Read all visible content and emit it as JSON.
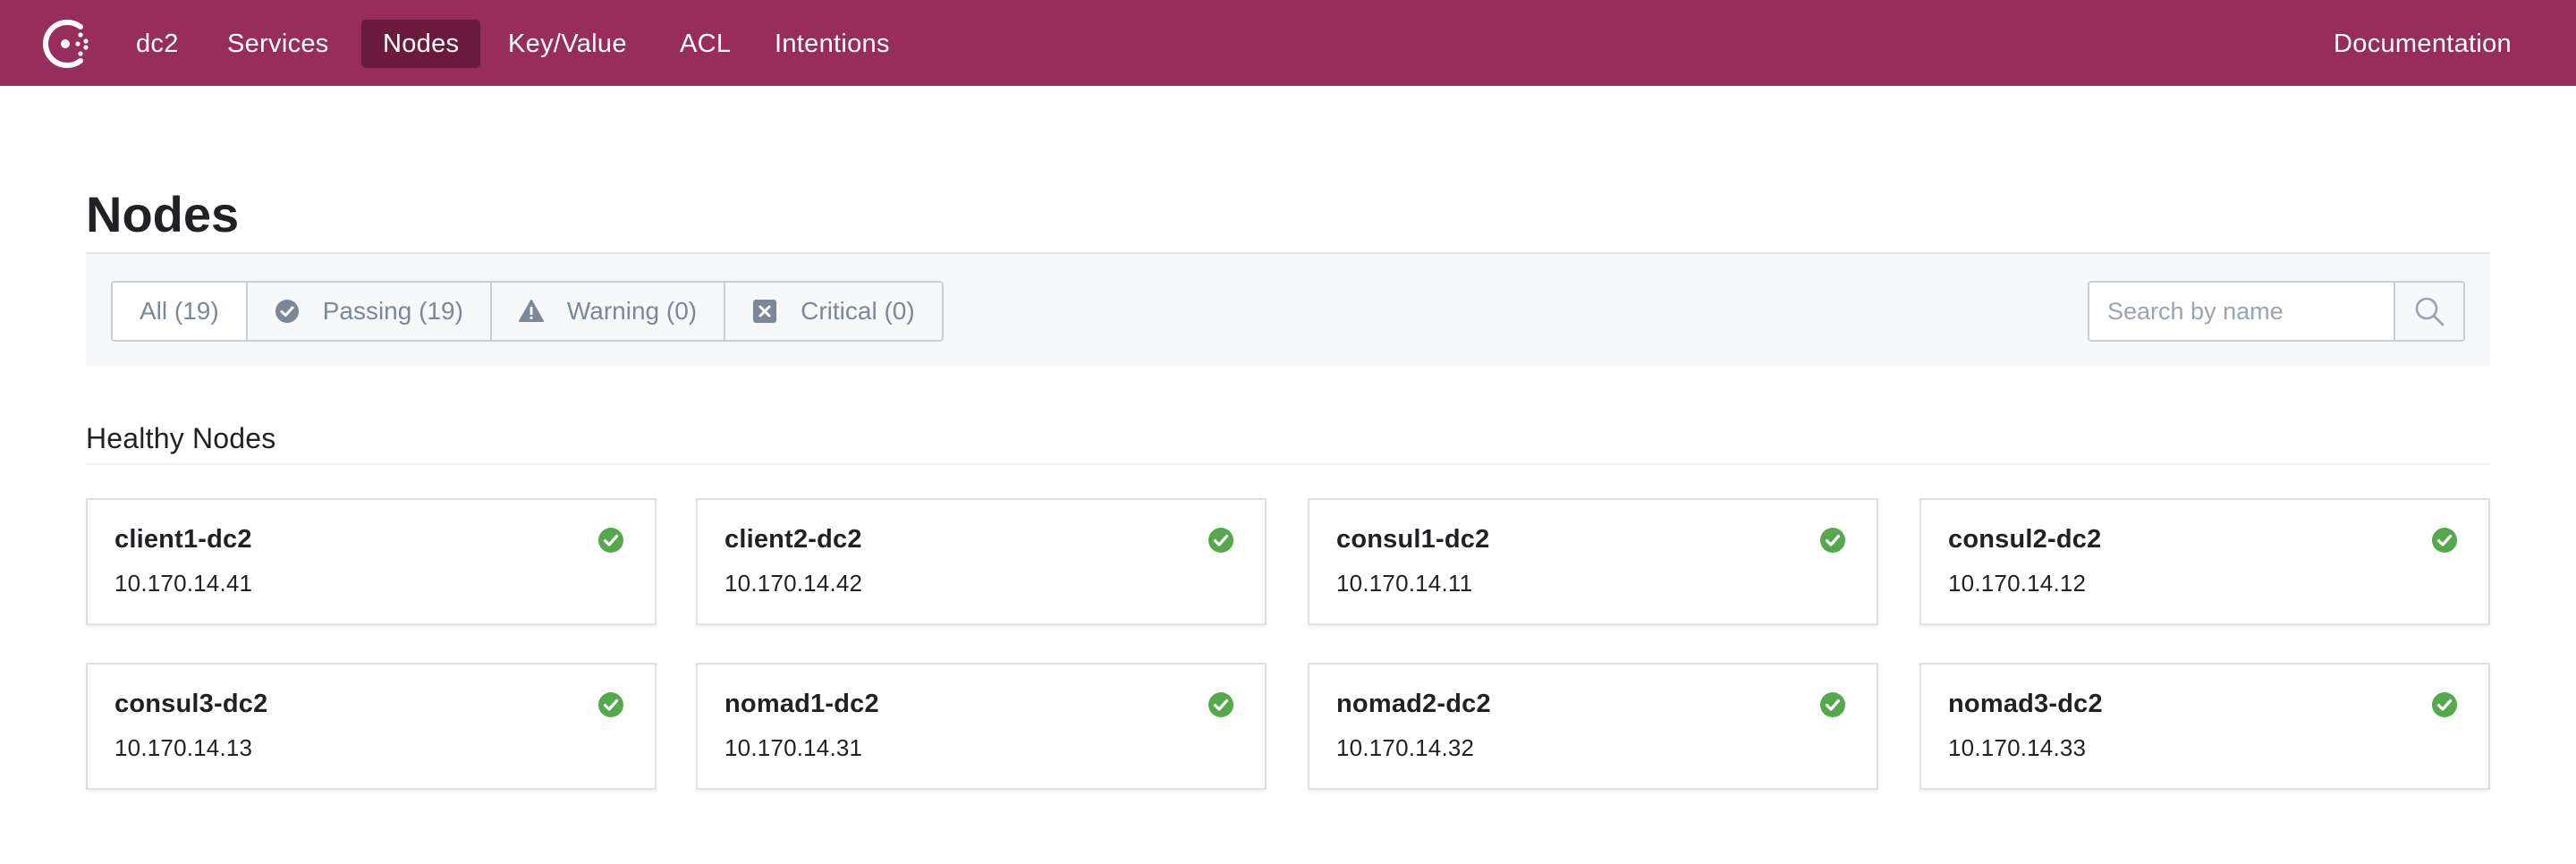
{
  "topnav": {
    "datacenter": "dc2",
    "items": [
      {
        "label": "Services",
        "active": false
      },
      {
        "label": "Nodes",
        "active": true
      },
      {
        "label": "Key/Value",
        "active": false
      },
      {
        "label": "ACL",
        "active": false
      },
      {
        "label": "Intentions",
        "active": false
      }
    ],
    "documentation": "Documentation",
    "brand_color": "#962d5b",
    "active_color": "#6a1b3c"
  },
  "page": {
    "title": "Nodes"
  },
  "filters": {
    "all": "All (19)",
    "passing": "Passing (19)",
    "warning": "Warning (0)",
    "critical": "Critical (0)"
  },
  "search": {
    "placeholder": "Search by name",
    "value": ""
  },
  "section": {
    "heading": "Healthy Nodes"
  },
  "nodes": [
    {
      "name": "client1-dc2",
      "address": "10.170.14.41",
      "status": "passing"
    },
    {
      "name": "client2-dc2",
      "address": "10.170.14.42",
      "status": "passing"
    },
    {
      "name": "consul1-dc2",
      "address": "10.170.14.11",
      "status": "passing"
    },
    {
      "name": "consul2-dc2",
      "address": "10.170.14.12",
      "status": "passing"
    },
    {
      "name": "consul3-dc2",
      "address": "10.170.14.13",
      "status": "passing"
    },
    {
      "name": "nomad1-dc2",
      "address": "10.170.14.31",
      "status": "passing"
    },
    {
      "name": "nomad2-dc2",
      "address": "10.170.14.32",
      "status": "passing"
    },
    {
      "name": "nomad3-dc2",
      "address": "10.170.14.33",
      "status": "passing"
    }
  ],
  "colors": {
    "passing": "#56a84d",
    "filter_icon": "#7c8797"
  }
}
